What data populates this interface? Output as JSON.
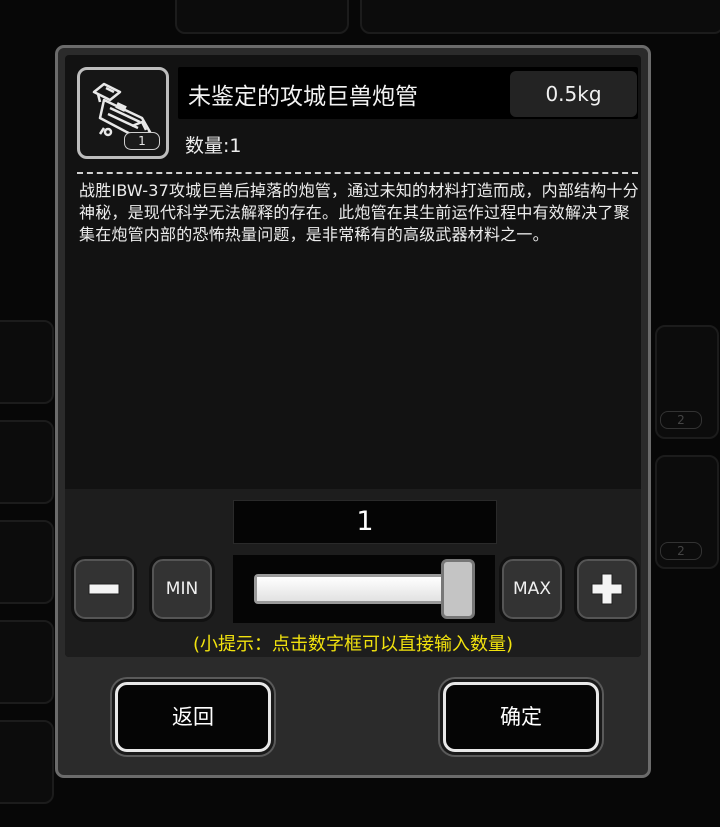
{
  "background": {
    "badges": [
      "2",
      "2"
    ]
  },
  "item": {
    "name": "未鉴定的攻城巨兽炮管",
    "weight": "0.5kg",
    "icon_count": "1",
    "quantity_label": "数量:1",
    "description": "战胜IBW-37攻城巨兽后掉落的炮管，通过未知的材料打造而成，内部结构十分神秘，是现代科学无法解释的存在。此炮管在其生前运作过程中有效解决了聚集在炮管内部的恐怖热量问题，是非常稀有的高级武器材料之一。",
    "icon": "cannon-barrel-icon"
  },
  "selector": {
    "count": "1",
    "min_label": "MIN",
    "max_label": "MAX",
    "slider_level": 1.0,
    "hint": "(小提示：点击数字框可以直接输入数量)"
  },
  "actions": {
    "back_label": "返回",
    "confirm_label": "确定"
  },
  "colors": {
    "hint": "#f1e20e",
    "dialog_bg": "#2b2b2b",
    "panel_bg": "#121212"
  }
}
